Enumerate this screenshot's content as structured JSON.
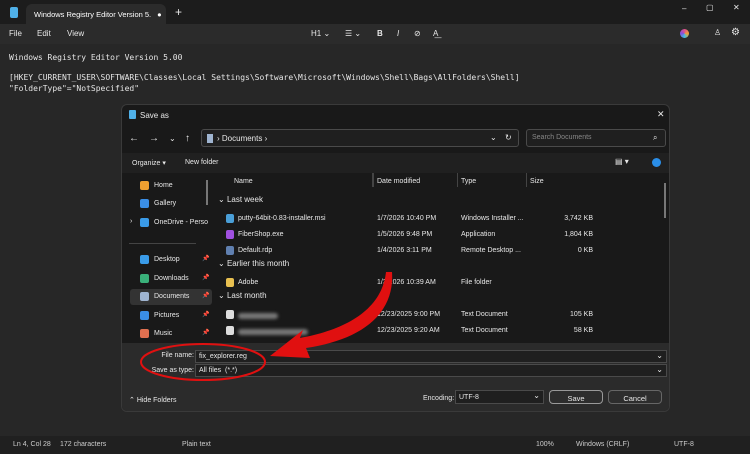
{
  "window": {
    "tab_title": "Windows Registry Editor Version 5.",
    "menu": [
      "File",
      "Edit",
      "View"
    ],
    "toolbar": {
      "heading": "H1 ⌄",
      "list": "☰ ⌄",
      "bold": "B",
      "italic": "I",
      "link": "⊘",
      "spell": "A͟"
    }
  },
  "editor": {
    "lines": [
      "Windows Registry Editor Version 5.00",
      "",
      "[HKEY_CURRENT_USER\\SOFTWARE\\Classes\\Local Settings\\Software\\Microsoft\\Windows\\Shell\\Bags\\AllFolders\\Shell]",
      "\"FolderType\"=\"NotSpecified\""
    ]
  },
  "status": {
    "position": "Ln 4, Col 28",
    "chars": "172 characters",
    "format": "Plain text",
    "zoom": "100%",
    "eol": "Windows (CRLF)",
    "encoding": "UTF-8"
  },
  "dialog": {
    "title": "Save as",
    "path": "Documents",
    "search_placeholder": "Search Documents",
    "organize": "Organize ▾",
    "new_folder": "New folder",
    "sidebar": [
      {
        "label": "Home",
        "color": "#f0a030"
      },
      {
        "label": "Gallery",
        "color": "#3a8ee6"
      },
      {
        "label": "OneDrive - Perso",
        "color": "#3a9be8"
      },
      {
        "label": "Desktop",
        "color": "#3a9be8"
      },
      {
        "label": "Downloads",
        "color": "#3ab07a"
      },
      {
        "label": "Documents",
        "color": "#9fb4d0"
      },
      {
        "label": "Pictures",
        "color": "#3a8ee6"
      },
      {
        "label": "Music",
        "color": "#e07050"
      }
    ],
    "columns": [
      "Name",
      "Date modified",
      "Type",
      "Size"
    ],
    "groups": [
      {
        "label": "Last week",
        "files": [
          {
            "name": "putty-64bit-0.83-installer.msi",
            "date": "1/7/2026 10:40 PM",
            "type": "Windows Installer ...",
            "size": "3,742 KB",
            "color": "#4a9fd8"
          },
          {
            "name": "FiberShop.exe",
            "date": "1/5/2026 9:48 PM",
            "type": "Application",
            "size": "1,804 KB",
            "color": "#a050e0"
          },
          {
            "name": "Default.rdp",
            "date": "1/4/2026 3:11 PM",
            "type": "Remote Desktop ...",
            "size": "0 KB",
            "color": "#6080b0"
          }
        ]
      },
      {
        "label": "Earlier this month",
        "files": [
          {
            "name": "Adobe",
            "date": "1/3/2026 10:39 AM",
            "type": "File folder",
            "size": "",
            "color": "#e8c050"
          }
        ]
      },
      {
        "label": "Last month",
        "files": [
          {
            "name": "",
            "date": "12/23/2025 9:00 PM",
            "type": "Text Document",
            "size": "105 KB",
            "color": "#ddd"
          },
          {
            "name": "",
            "date": "12/23/2025 9:20 AM",
            "type": "Text Document",
            "size": "58 KB",
            "color": "#ddd"
          }
        ]
      }
    ],
    "file_name_label": "File name:",
    "file_name": "fix_explorer.reg",
    "save_type_label": "Save as type:",
    "save_type": "All files  (*.*)",
    "hide_folders": "Hide Folders",
    "encoding_label": "Encoding:",
    "encoding": "UTF-8",
    "save": "Save",
    "cancel": "Cancel"
  },
  "annotation_color": "#e01010"
}
